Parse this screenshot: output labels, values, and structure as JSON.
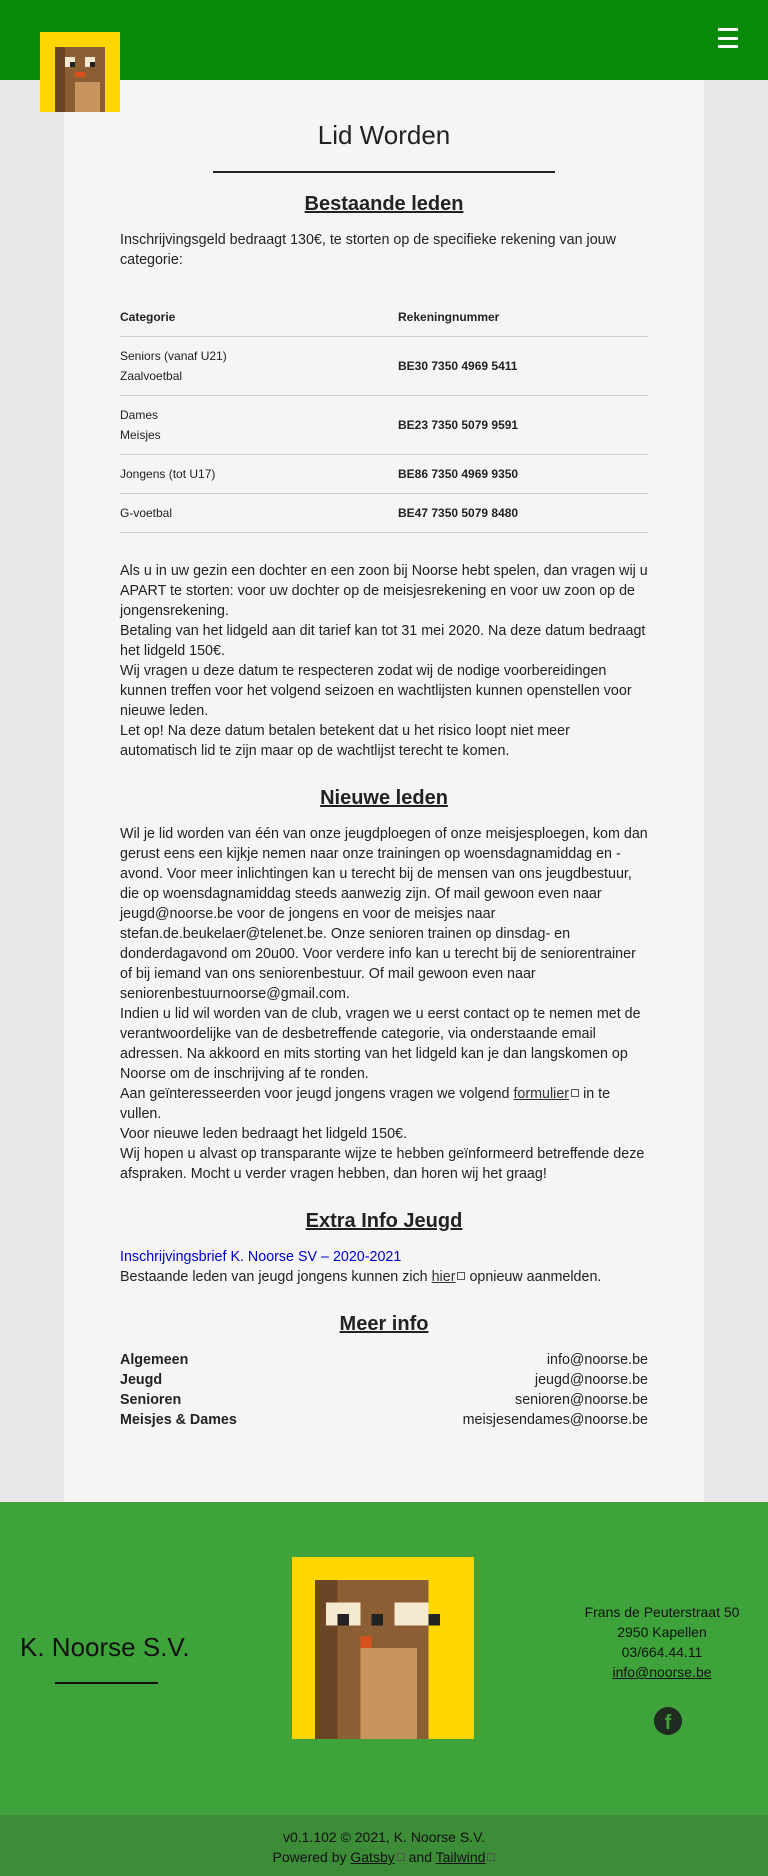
{
  "header": {
    "logo_icon": "beaver-logo-icon",
    "menu_icon": "hamburger-menu-icon",
    "colors": {
      "header_bg": "#0a8a0a",
      "logo_bg": "#ffd700"
    }
  },
  "page": {
    "title": "Lid Worden",
    "sections": {
      "existing": {
        "heading": "Bestaande leden",
        "intro": "Inschrijvingsgeld bedraagt 130€, te storten op de specifieke rekening van jouw categorie:",
        "table": {
          "headers": [
            "Categorie",
            "Rekeningnummer"
          ],
          "rows": [
            {
              "category": [
                "Seniors (vanaf U21)",
                "Zaalvoetbal"
              ],
              "account": "BE30 7350 4969 5411"
            },
            {
              "category": [
                "Dames",
                "Meisjes"
              ],
              "account": "BE23 7350 5079 9591"
            },
            {
              "category": [
                "Jongens (tot U17)"
              ],
              "account": "BE86 7350 4969 9350"
            },
            {
              "category": [
                "G-voetbal"
              ],
              "account": "BE47 7350 5079 8480"
            }
          ]
        },
        "paragraphs": [
          "Als u in uw gezin een dochter en een zoon bij Noorse hebt spelen, dan vragen wij u APART te storten: voor uw dochter op de meisjesrekening en voor uw zoon op de jongensrekening.",
          "Betaling van het lidgeld aan dit tarief kan tot 31 mei 2020. Na deze datum bedraagt het lidgeld 150€.",
          "Wij vragen u deze datum te respecteren zodat wij de nodige voorbereidingen kunnen treffen voor het volgend seizoen en wachtlijsten kunnen openstellen voor nieuwe leden.",
          "Let op! Na deze datum betalen betekent dat u het risico loopt niet meer automatisch lid te zijn maar op de wachtlijst terecht te komen."
        ]
      },
      "new": {
        "heading": "Nieuwe leden",
        "p1": "Wil je lid worden van één van onze jeugdploegen of onze meisjesploegen, kom dan gerust eens een kijkje nemen naar onze trainingen op woensdagnamiddag en -avond. Voor meer inlichtingen kan u terecht bij de mensen van ons jeugdbestuur, die op woensdagnamiddag steeds aanwezig zijn. Of mail gewoon even naar jeugd@noorse.be voor de jongens en voor de meisjes naar stefan.de.beukelaer@telenet.be. Onze senioren trainen op dinsdag- en donderdagavond om 20u00. Voor verdere info kan u terecht bij de seniorentrainer of bij iemand van ons seniorenbestuur. Of mail gewoon even naar seniorenbestuurnoorse@gmail.com.",
        "p2": "Indien u lid wil worden van de club, vragen we u eerst contact op te nemen met de verantwoordelijke van de desbetreffende categorie, via onderstaande email adressen. Na akkoord en mits storting van het lidgeld kan je dan langskomen op Noorse om de inschrijving af te ronden.",
        "p3_before": "Aan geïnteresseerden voor jeugd jongens vragen we volgend",
        "p3_link": "formulier",
        "p3_after": "in te vullen.",
        "p4": "Voor nieuwe leden bedraagt het lidgeld 150€.",
        "p5": "Wij hopen u alvast op transparante wijze te hebben geïnformeerd betreffende deze afspraken. Mocht u verder vragen hebben, dan horen wij het graag!"
      },
      "extra": {
        "heading": "Extra Info Jeugd",
        "link": "Inschrijvingsbrief K. Noorse SV – 2020-2021",
        "line_before": "Bestaande leden van jeugd jongens kunnen zich",
        "line_link": "hier",
        "line_after": "opnieuw aanmelden."
      },
      "more": {
        "heading": "Meer info",
        "rows": [
          {
            "label": "Algemeen",
            "email": "info@noorse.be"
          },
          {
            "label": "Jeugd",
            "email": "jeugd@noorse.be"
          },
          {
            "label": "Senioren",
            "email": "senioren@noorse.be"
          },
          {
            "label": "Meisjes & Dames",
            "email": "meisjesendames@noorse.be"
          }
        ]
      }
    }
  },
  "footer": {
    "club_name": "K. Noorse S.V.",
    "address": [
      "Frans de Peuterstraat 50",
      "2950 Kapellen",
      "03/664.44.11"
    ],
    "email": "info@noorse.be",
    "facebook_icon": "facebook-icon",
    "version_line": "v0.1.102 © 2021, K. Noorse S.V.",
    "powered_prefix": "Powered by",
    "gatsby": "Gatsby",
    "and": "and",
    "tailwind": "Tailwind",
    "colors": {
      "footer_bg": "#3ea33a",
      "bottom_bg": "#3c8c38"
    }
  }
}
